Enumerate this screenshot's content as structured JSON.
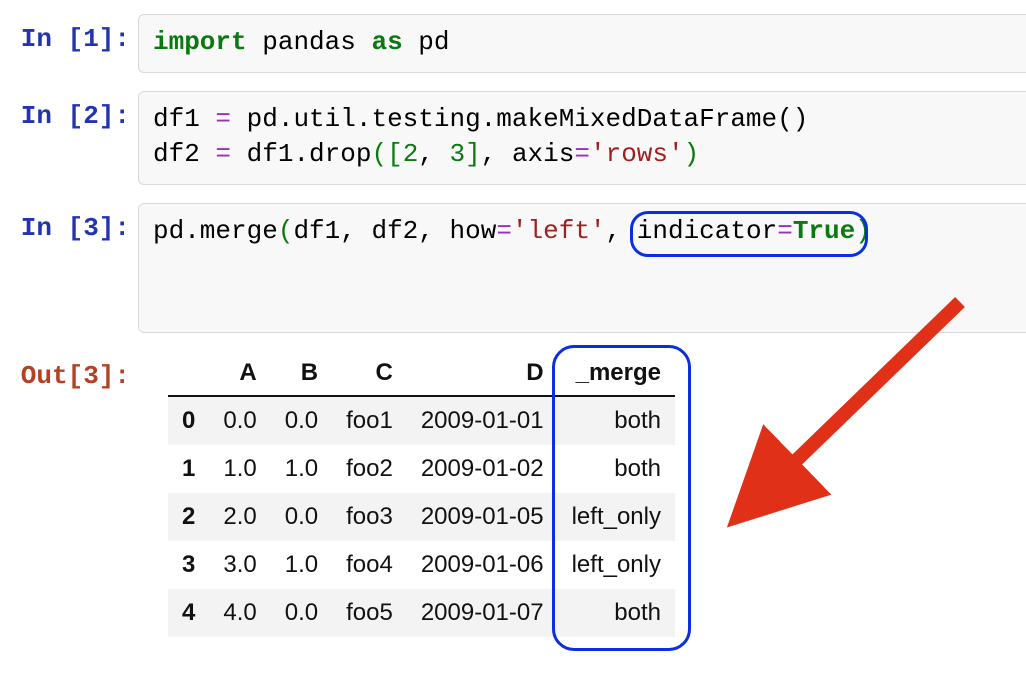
{
  "cells": {
    "in1": {
      "prompt": "In [1]:",
      "tokens": {
        "import": "import",
        "pandas": "pandas",
        "as": "as",
        "pd": "pd"
      }
    },
    "in2": {
      "prompt": "In [2]:",
      "line1": {
        "df1": "df1",
        "eq": "=",
        "expr": "pd.util.testing.makeMixedDataFrame()"
      },
      "line2": {
        "df2": "df2",
        "eq": "=",
        "head": "df1.drop",
        "lpar": "(",
        "lb": "[",
        "n2": "2",
        "comma1": ",",
        "n3": "3",
        "rb": "]",
        "comma2": ",",
        "axis_kw": "axis",
        "eq2": "=",
        "axis_val": "'rows'",
        "rpar": ")"
      }
    },
    "in3": {
      "prompt": "In [3]:",
      "tokens": {
        "head": "pd.merge",
        "lpar": "(",
        "df1": "df1",
        "c1": ",",
        "df2": "df2",
        "c2": ",",
        "how_kw": "how",
        "eq1": "=",
        "how_val": "'left'",
        "c3": ",",
        "ind_kw": "indicator",
        "eq2": "=",
        "ind_val": "True",
        "rpar": ")"
      }
    },
    "out3": {
      "prompt": "Out[3]:",
      "columns": [
        "A",
        "B",
        "C",
        "D",
        "_merge"
      ],
      "index": [
        "0",
        "1",
        "2",
        "3",
        "4"
      ],
      "rows": [
        [
          "0.0",
          "0.0",
          "foo1",
          "2009-01-01",
          "both"
        ],
        [
          "1.0",
          "1.0",
          "foo2",
          "2009-01-02",
          "both"
        ],
        [
          "2.0",
          "0.0",
          "foo3",
          "2009-01-05",
          "left_only"
        ],
        [
          "3.0",
          "1.0",
          "foo4",
          "2009-01-06",
          "left_only"
        ],
        [
          "4.0",
          "0.0",
          "foo5",
          "2009-01-07",
          "both"
        ]
      ]
    }
  },
  "chart_data": {
    "type": "table",
    "title": "Out[3]",
    "columns": [
      "",
      "A",
      "B",
      "C",
      "D",
      "_merge"
    ],
    "rows": [
      [
        "0",
        0.0,
        0.0,
        "foo1",
        "2009-01-01",
        "both"
      ],
      [
        "1",
        1.0,
        1.0,
        "foo2",
        "2009-01-02",
        "both"
      ],
      [
        "2",
        2.0,
        0.0,
        "foo3",
        "2009-01-05",
        "left_only"
      ],
      [
        "3",
        3.0,
        1.0,
        "foo4",
        "2009-01-06",
        "left_only"
      ],
      [
        "4",
        4.0,
        0.0,
        "foo5",
        "2009-01-07",
        "both"
      ]
    ]
  },
  "annotations": {
    "indicator_ring_target": "indicator=True",
    "merge_ring_column": "_merge",
    "arrow_color": "#e03018"
  }
}
